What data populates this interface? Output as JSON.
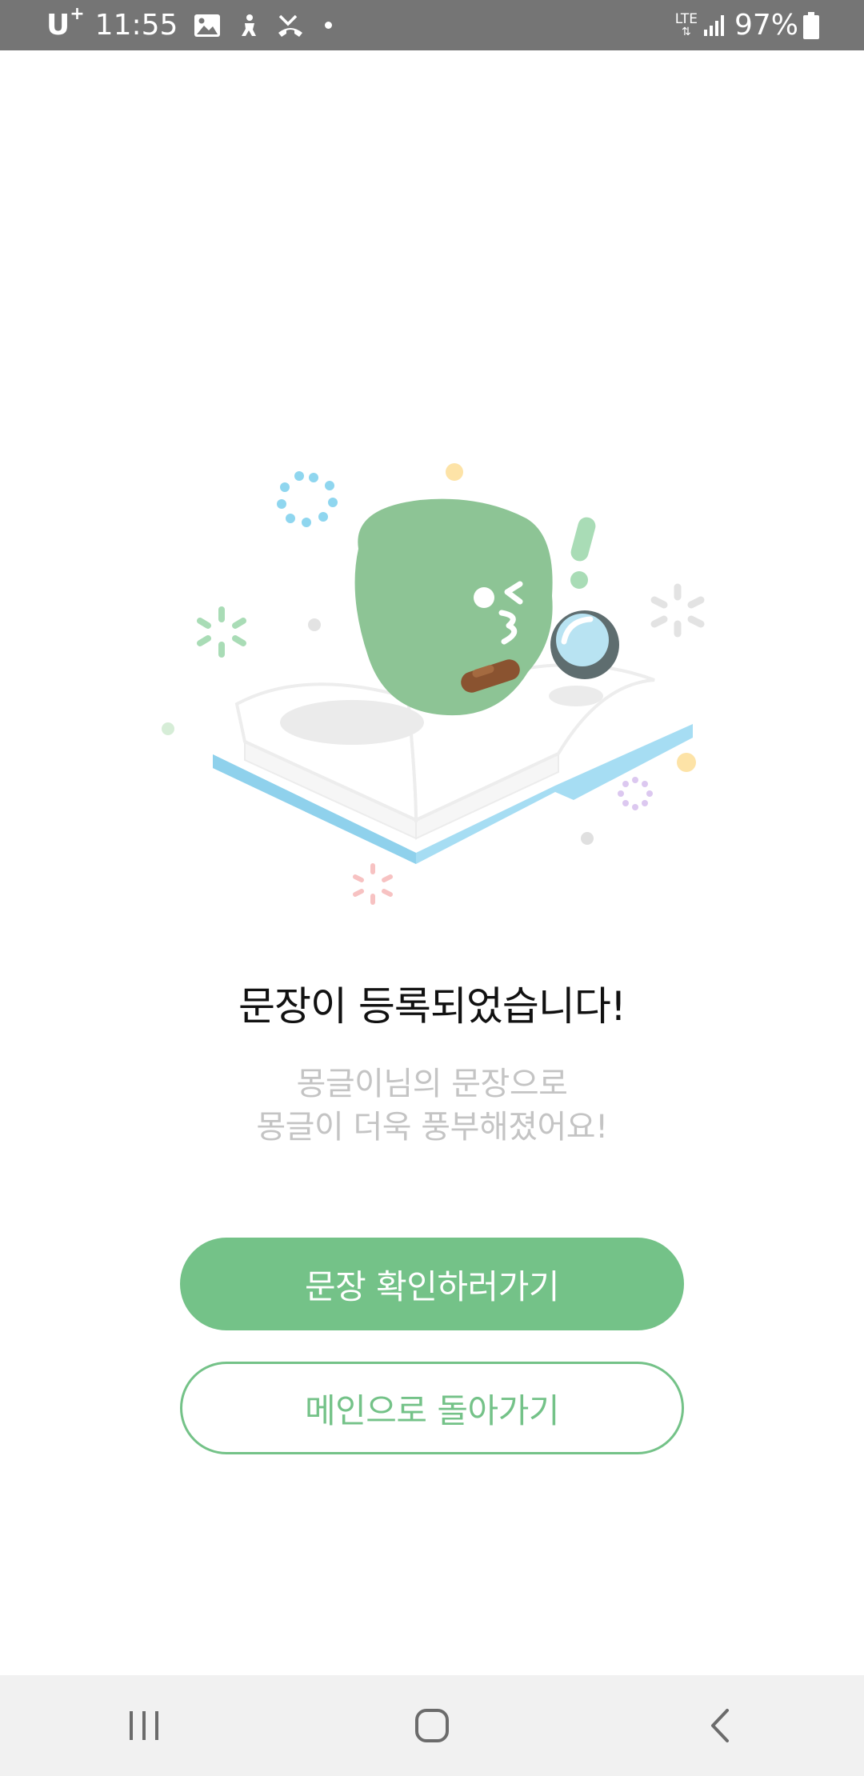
{
  "status_bar": {
    "carrier": "U",
    "carrier_sup": "+",
    "time": "11:55",
    "network": "LTE",
    "battery_percent": "97%",
    "icons": [
      "gallery-icon",
      "accessibility-icon",
      "missed-call-icon",
      "notification-dot-icon",
      "lte-icon",
      "signal-icon",
      "battery-icon"
    ]
  },
  "main": {
    "headline": "문장이 등록되었습니다!",
    "subtext_line1": "몽글이님의 문장으로",
    "subtext_line2": "몽글이 더욱 풍부해졌어요!",
    "primary_button": "문장 확인하러가기",
    "secondary_button": "메인으로 돌아가기"
  },
  "nav_bar": {
    "icons": [
      "recent-apps-icon",
      "home-icon",
      "back-icon"
    ]
  },
  "colors": {
    "accent": "#74c288",
    "status_bar": "#757575",
    "nav_bar": "#f1f1f1",
    "headline": "#111111",
    "subtext": "#c4c4c4"
  }
}
